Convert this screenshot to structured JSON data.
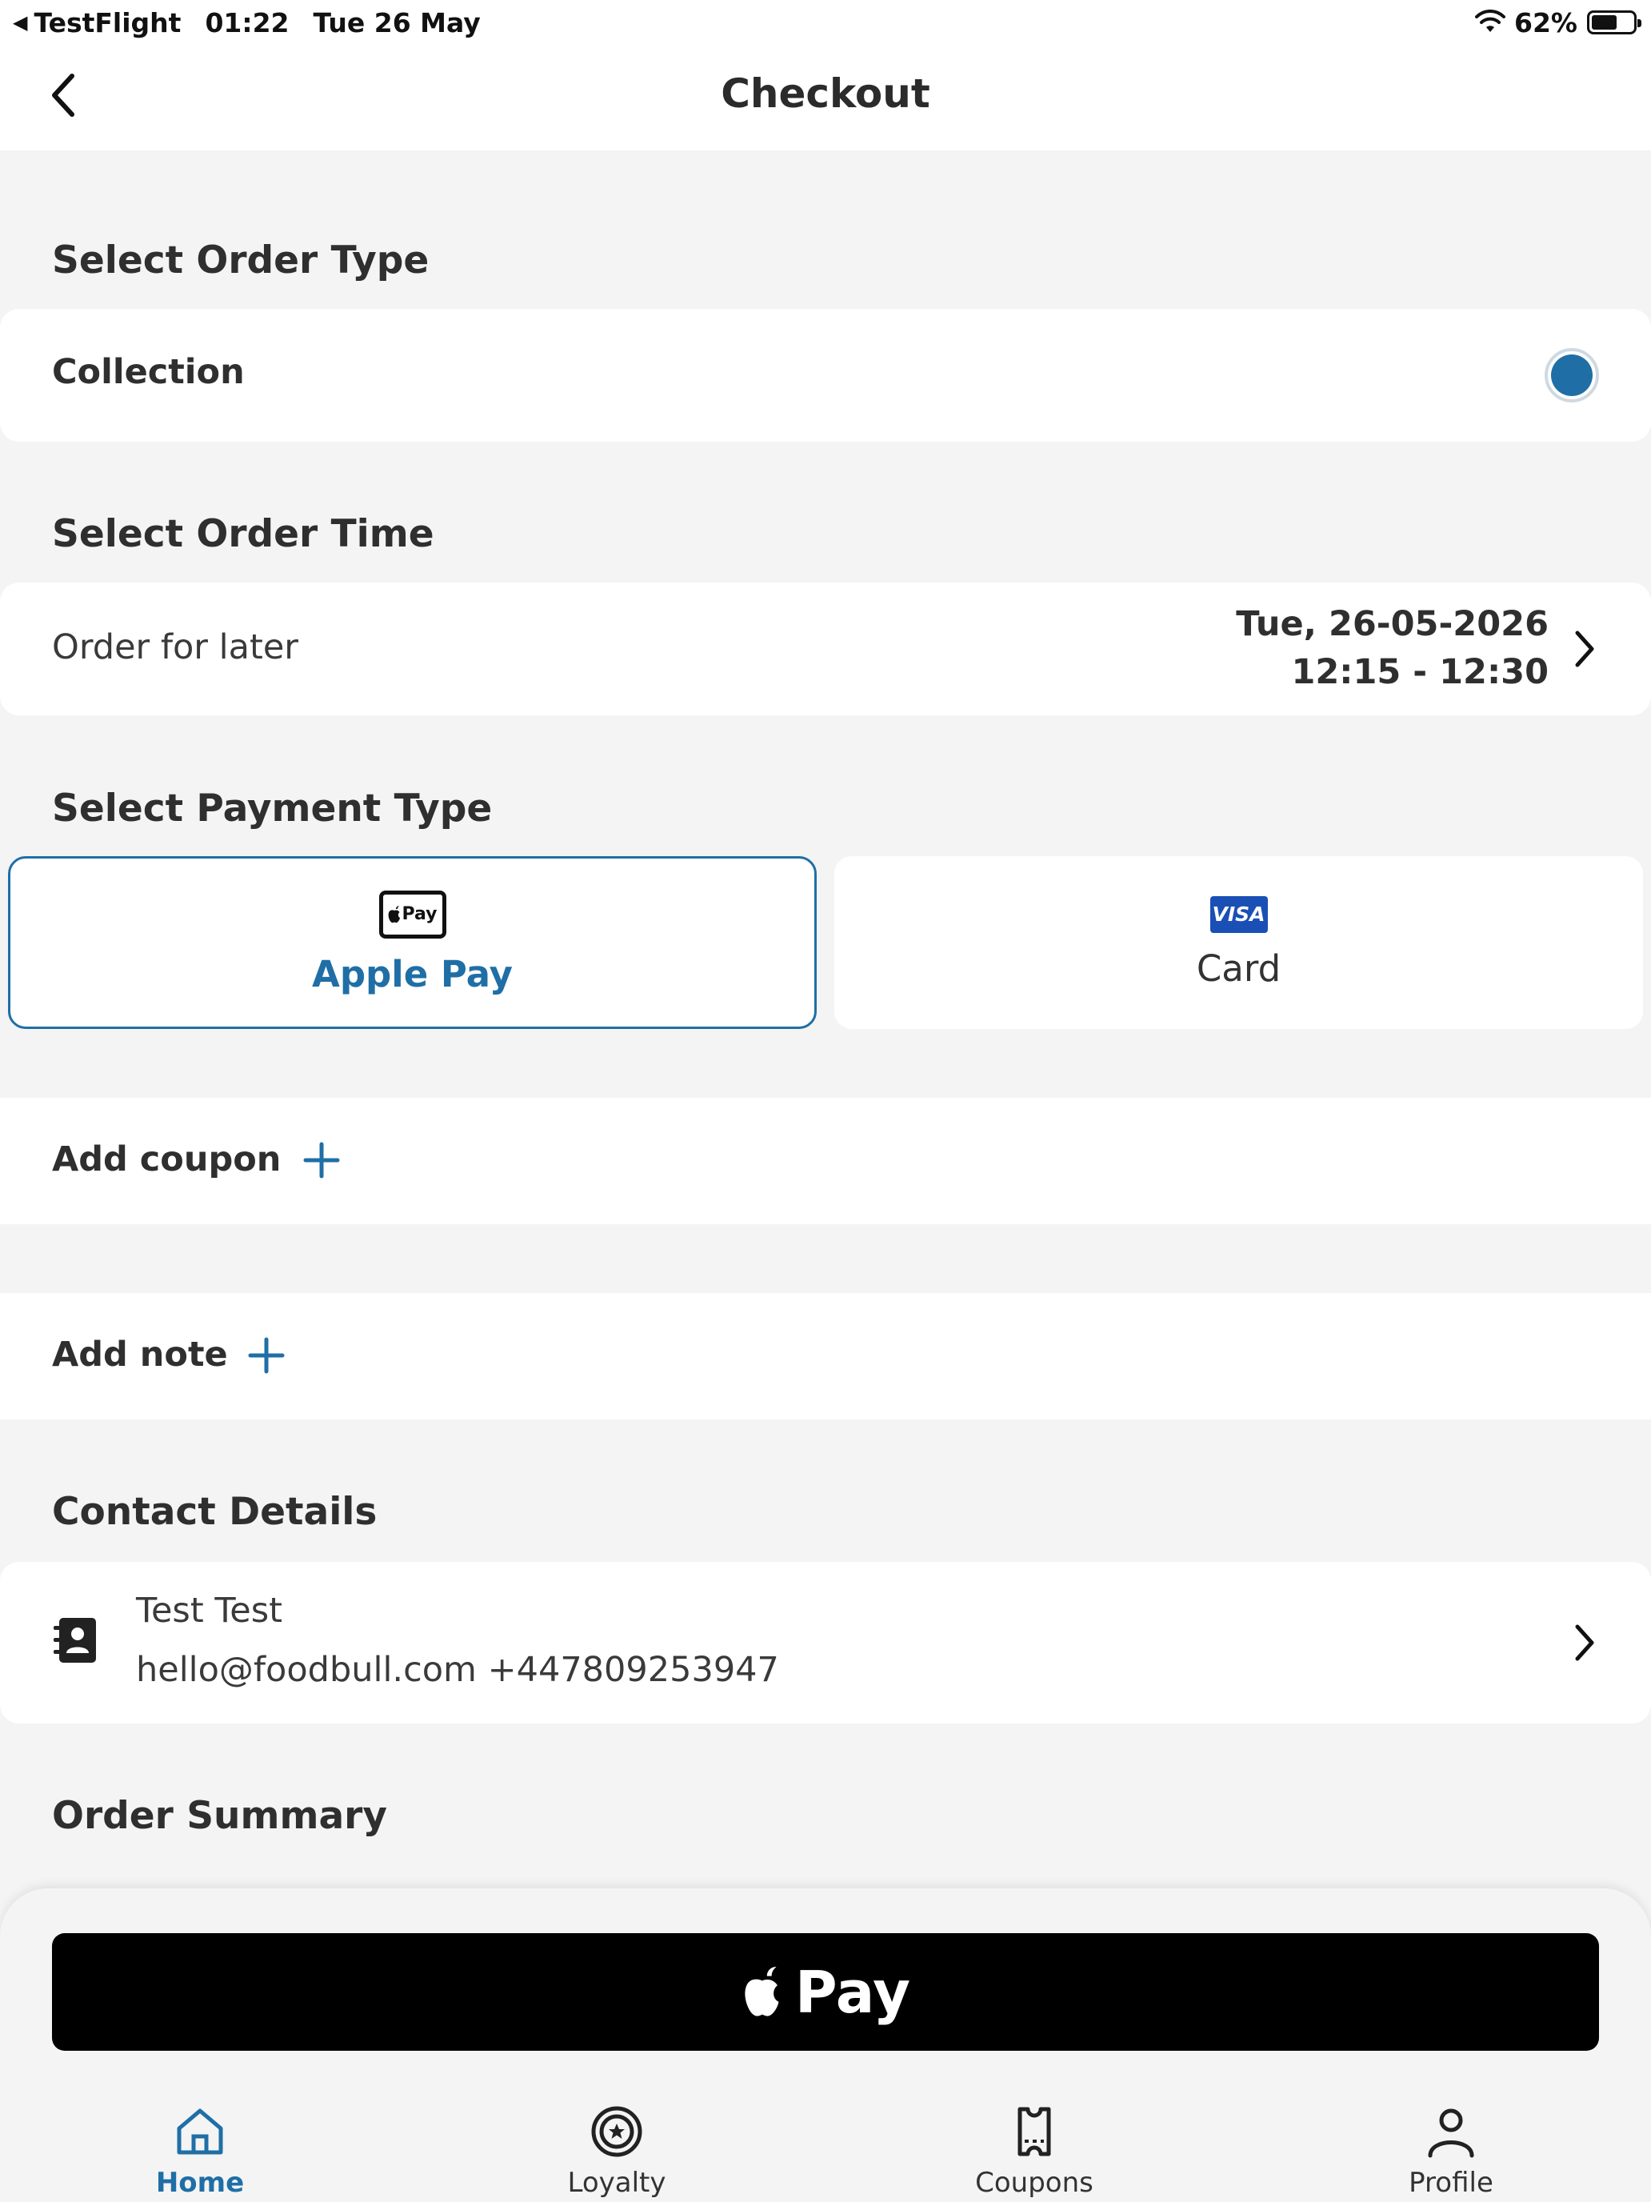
{
  "status_bar": {
    "app": "TestFlight",
    "time": "01:22",
    "date": "Tue 26 May",
    "battery_text": "62%",
    "battery_level": 0.62
  },
  "header": {
    "title": "Checkout",
    "back_icon": "chevron-left-icon"
  },
  "order_type": {
    "section_title": "Select Order Type",
    "option_label": "Collection",
    "selected": true
  },
  "order_time": {
    "section_title": "Select Order Time",
    "label": "Order for later",
    "date": "Tue, 26-05-2026",
    "slot": "12:15 - 12:30"
  },
  "payment": {
    "section_title": "Select Payment Type",
    "options": [
      {
        "label": "Apple Pay",
        "icon": "apple-pay-icon",
        "mark_text": "Pay",
        "selected": true
      },
      {
        "label": "Card",
        "icon": "visa-icon",
        "mark_text": "VISA",
        "selected": false
      }
    ]
  },
  "coupon": {
    "label": "Add coupon"
  },
  "note": {
    "label": "Add note"
  },
  "contact": {
    "section_title": "Contact Details",
    "name": "Test Test",
    "details": "hello@foodbull.com +447809253947"
  },
  "summary": {
    "section_title": "Order Summary"
  },
  "apple_pay_button": {
    "label": "Pay"
  },
  "tab_bar": {
    "items": [
      {
        "label": "Home",
        "icon": "home-icon",
        "active": true
      },
      {
        "label": "Loyalty",
        "icon": "loyalty-icon",
        "active": false
      },
      {
        "label": "Coupons",
        "icon": "coupons-icon",
        "active": false
      },
      {
        "label": "Profile",
        "icon": "profile-icon",
        "active": false
      }
    ]
  },
  "colors": {
    "accent": "#1f6fa6",
    "background": "#f4f4f4",
    "card": "#ffffff",
    "visa": "#1a4fb5"
  }
}
